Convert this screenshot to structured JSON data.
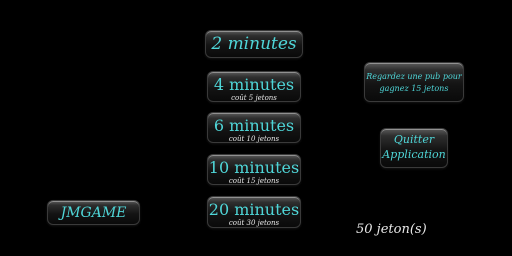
{
  "timers": [
    {
      "label": "2 minutes",
      "cost": ""
    },
    {
      "label": "4 minutes",
      "cost": "coût 5 jetons"
    },
    {
      "label": "6 minutes",
      "cost": "coût 10 jetons"
    },
    {
      "label": "10 minutes",
      "cost": "coût 15 jetons"
    },
    {
      "label": "20 minutes",
      "cost": "coût 30 jetons"
    }
  ],
  "ad_button": {
    "line1": "Regardez une pub pour",
    "line2": "gagnez 15 jetons"
  },
  "quit_button": {
    "line1": "Quitter",
    "line2": "Application"
  },
  "brand_button": {
    "label": "JMGAME"
  },
  "token_balance": "50 jeton(s)",
  "colors": {
    "accent": "#4fd6d8",
    "text": "#e8e8e8",
    "background": "#000000"
  }
}
